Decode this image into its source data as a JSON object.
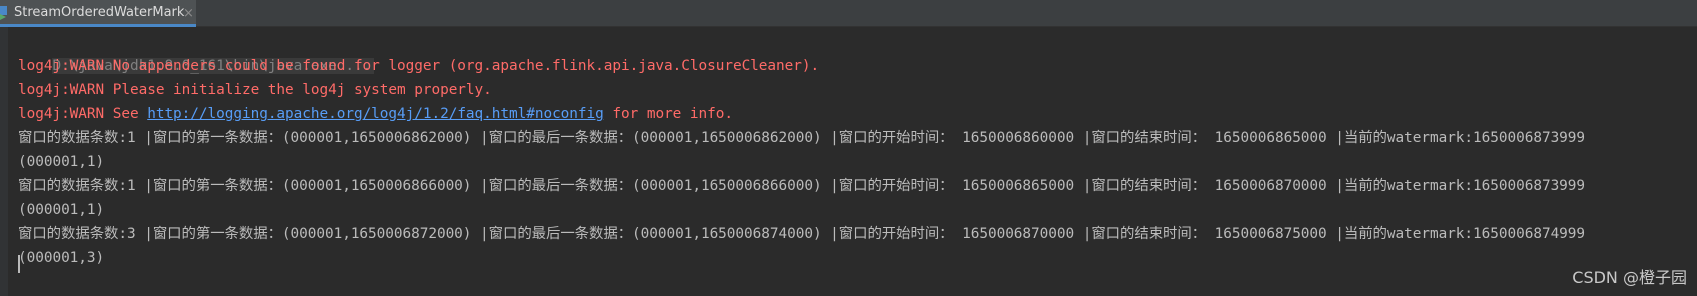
{
  "tab": {
    "title": "StreamOrderedWaterMark",
    "close_glyph": "×",
    "icon": "run-config-icon"
  },
  "console": {
    "command": "D:\\java\\jdk1.8.0_161\\bin\\java.exe ...",
    "warn1": "log4j:WARN No appenders could be found for logger (org.apache.flink.api.java.ClosureCleaner).",
    "warn2": "log4j:WARN Please initialize the log4j system properly.",
    "warn3_prefix": "log4j:WARN See ",
    "warn3_link": "http://logging.apache.org/log4j/1.2/faq.html#noconfig",
    "warn3_suffix": " for more info.",
    "output": [
      "窗口的数据条数:1 |窗口的第一条数据：(000001,1650006862000) |窗口的最后一条数据：(000001,1650006862000) |窗口的开始时间： 1650006860000 |窗口的结束时间： 1650006865000 |当前的watermark:1650006873999",
      "(000001,1)",
      "窗口的数据条数:1 |窗口的第一条数据：(000001,1650006866000) |窗口的最后一条数据：(000001,1650006866000) |窗口的开始时间： 1650006865000 |窗口的结束时间： 1650006870000 |当前的watermark:1650006873999",
      "(000001,1)",
      "窗口的数据条数:3 |窗口的第一条数据：(000001,1650006872000) |窗口的最后一条数据：(000001,1650006874000) |窗口的开始时间： 1650006870000 |窗口的结束时间： 1650006875000 |当前的watermark:1650006874999",
      "(000001,3)"
    ]
  },
  "watermark": "CSDN @橙子园",
  "colors": {
    "background": "#2b2b2b",
    "warn": "#ff6b68",
    "link": "#589df6",
    "text": "#bbbbbb"
  }
}
